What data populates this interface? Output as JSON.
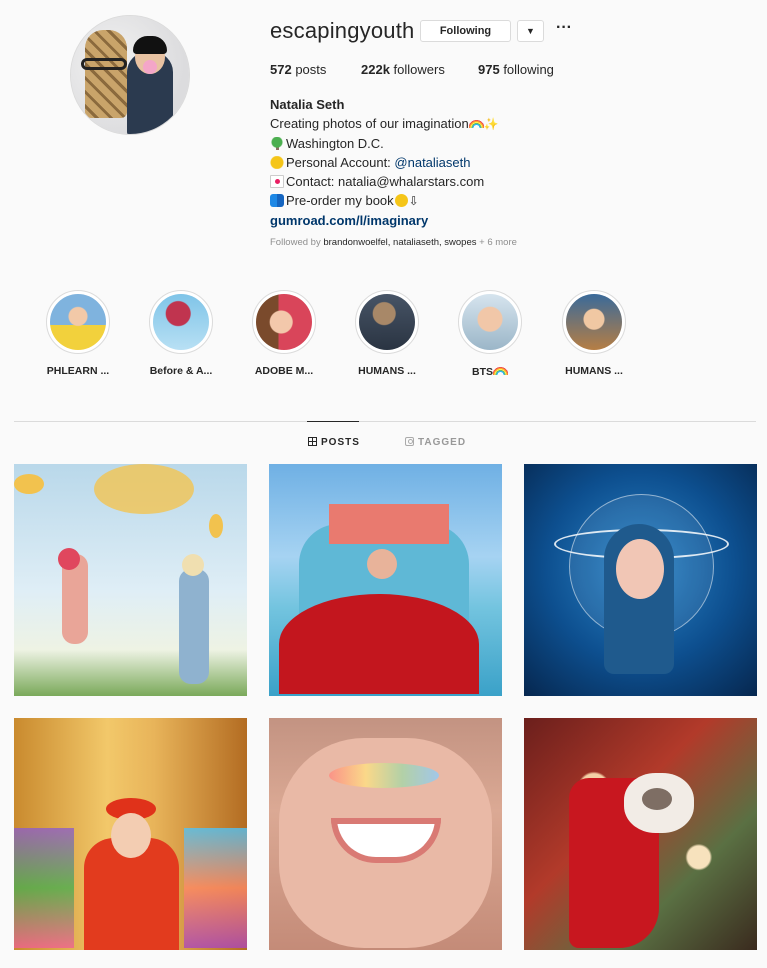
{
  "profile": {
    "username": "escapingyouth",
    "follow_label": "Following",
    "dropdown_icon": "chevron-down-icon",
    "more_icon": "more-options-icon",
    "posts_count": "572",
    "posts_label": " posts",
    "followers_count": "222k",
    "followers_label": " followers",
    "following_count": "975",
    "following_label": " following"
  },
  "bio": {
    "name": "Natalia Seth",
    "line1": "Creating photos of our imagination",
    "line2": "Washington D.C.",
    "line3_prefix": "Personal Account: ",
    "line3_link": "@nataliaseth",
    "line4": "Contact: natalia@whalarstars.com",
    "line5": "Pre-order my book",
    "website": "gumroad.com/l/imaginary"
  },
  "followed_by": {
    "prefix": "Followed by ",
    "names": "brandonwoelfel, nataliaseth, swopes",
    "more": " + 6 more"
  },
  "highlights": [
    {
      "label": "PHLEARN ..."
    },
    {
      "label": "Before & A..."
    },
    {
      "label": "ADOBE M..."
    },
    {
      "label": "HUMANS ..."
    },
    {
      "label": "BTS"
    },
    {
      "label": "HUMANS ..."
    }
  ],
  "tabs": {
    "posts": "POSTS",
    "tagged": "TAGGED"
  },
  "posts": [
    {
      "desc": "bananas-swing"
    },
    {
      "desc": "red-gown-castle"
    },
    {
      "desc": "space-helmet"
    },
    {
      "desc": "painted-hands"
    },
    {
      "desc": "true-smile"
    },
    {
      "desc": "cat-stocking"
    }
  ]
}
